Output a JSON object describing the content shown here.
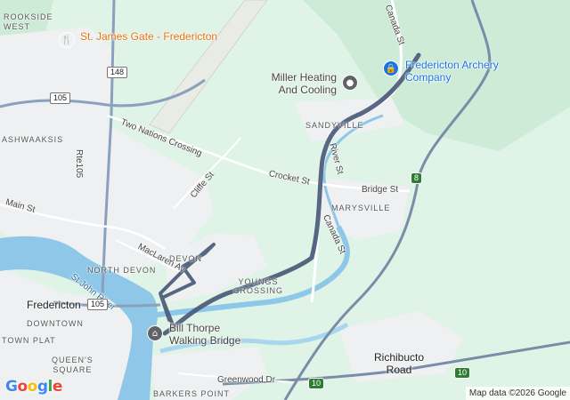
{
  "map": {
    "pois": [
      {
        "name": "St. James Gate - Fredericton",
        "icon": "restaurant-icon",
        "color": "#f57c00"
      },
      {
        "name": "Miller Heating And Cooling",
        "icon": "place-icon",
        "color": "#5f6368"
      },
      {
        "name": "Fredericton Archery Company",
        "icon": "shopping-bag-icon",
        "color": "#1a73e8"
      },
      {
        "name": "Bill Thorpe Walking Bridge",
        "icon": "bridge-icon",
        "color": "#5f6368"
      }
    ],
    "labels": {
      "brookside_west": "ROOKSIDE\nWEST",
      "nashwaaksis": "ASHWAAKSIS",
      "rte105": "Rte105",
      "two_nations": "Two Nations Crossing",
      "cliffe": "Cliffe St",
      "crocket": "Crocket St",
      "river_st": "River St",
      "canada_st_top": "Canada St",
      "canada_st_mid": "Canada St",
      "bridge_st": "Bridge St",
      "sandyville": "SANDYVILLE",
      "marysville": "MARYSVILLE",
      "main_st": "Main St",
      "maclaren": "MacLaren Av",
      "devon": "DEVON",
      "north_devon": "NORTH DEVON",
      "youngs_crossing": "YOUNGS\nCROSSING",
      "st_john_river": "St John River",
      "fredericton": "Fredericton",
      "downtown": "DOWNTOWN",
      "town_plat": "TOWN PLAT",
      "queens_square": "QUEEN'S\nSQUARE",
      "greenwood": "Greenwood Dr",
      "barkers_point": "BARKERS POINT",
      "richibucto_road": "Richibucto\nRoad"
    },
    "shields": {
      "r148": "148",
      "r105a": "105",
      "r105b": "105",
      "r8": "8",
      "r10a": "10",
      "r10b": "10"
    },
    "colors": {
      "route": "#4a5a7a",
      "water": "#8ec7e8",
      "land": "#dff3e6",
      "urban": "#eef0f2",
      "major_road": "#7a8ca8"
    },
    "logo": "Google",
    "attribution": "Map data ©2026 Google"
  }
}
